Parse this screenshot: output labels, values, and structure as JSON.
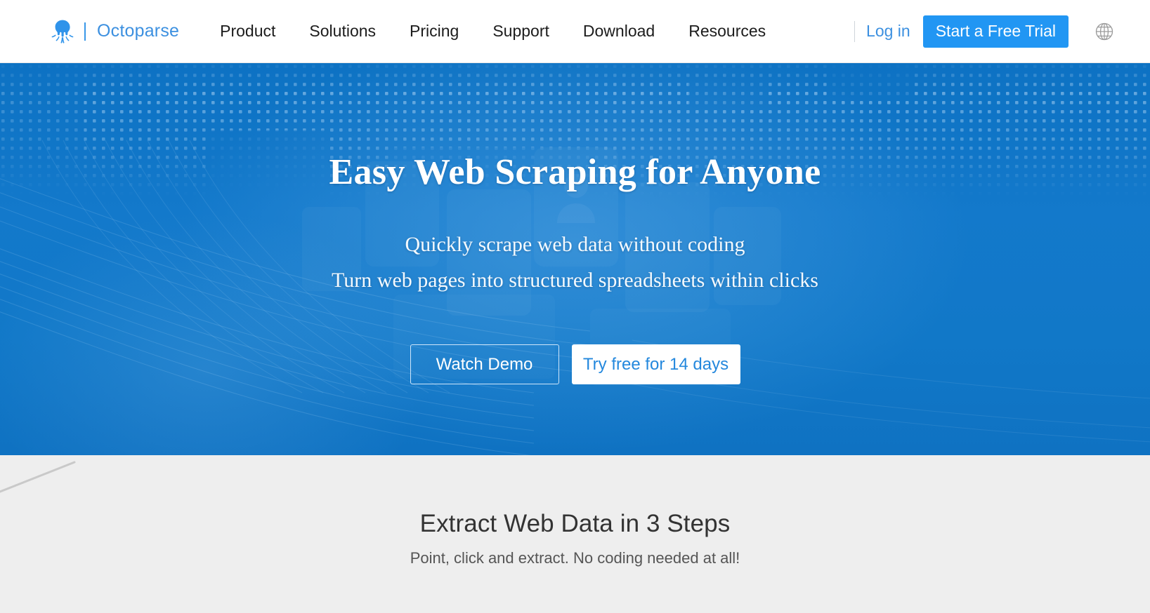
{
  "header": {
    "logo_icon": "octopus-logo-icon",
    "brand_name": "Octoparse",
    "nav_items": [
      {
        "label": "Product"
      },
      {
        "label": "Solutions"
      },
      {
        "label": "Pricing"
      },
      {
        "label": "Support"
      },
      {
        "label": "Download"
      },
      {
        "label": "Resources"
      }
    ],
    "login_label": "Log in",
    "trial_label": "Start a Free Trial",
    "language_icon": "globe-icon"
  },
  "hero": {
    "title": "Easy Web Scraping for Anyone",
    "subtitle_line1": "Quickly scrape web data without coding",
    "subtitle_line2": "Turn web pages into structured spreadsheets within clicks",
    "demo_button": "Watch Demo",
    "trial_button": "Try free for 14 days"
  },
  "steps": {
    "title": "Extract Web Data in 3 Steps",
    "subtitle": "Point, click and extract. No coding needed at all!"
  },
  "colors": {
    "brand_blue": "#3c90e0",
    "accent_button": "#2196f3",
    "hero_background": "#1178c8",
    "section_background": "#eeeeee",
    "header_background": "#ffffff",
    "nav_text": "#1c1c1c",
    "steps_title": "#333333"
  }
}
